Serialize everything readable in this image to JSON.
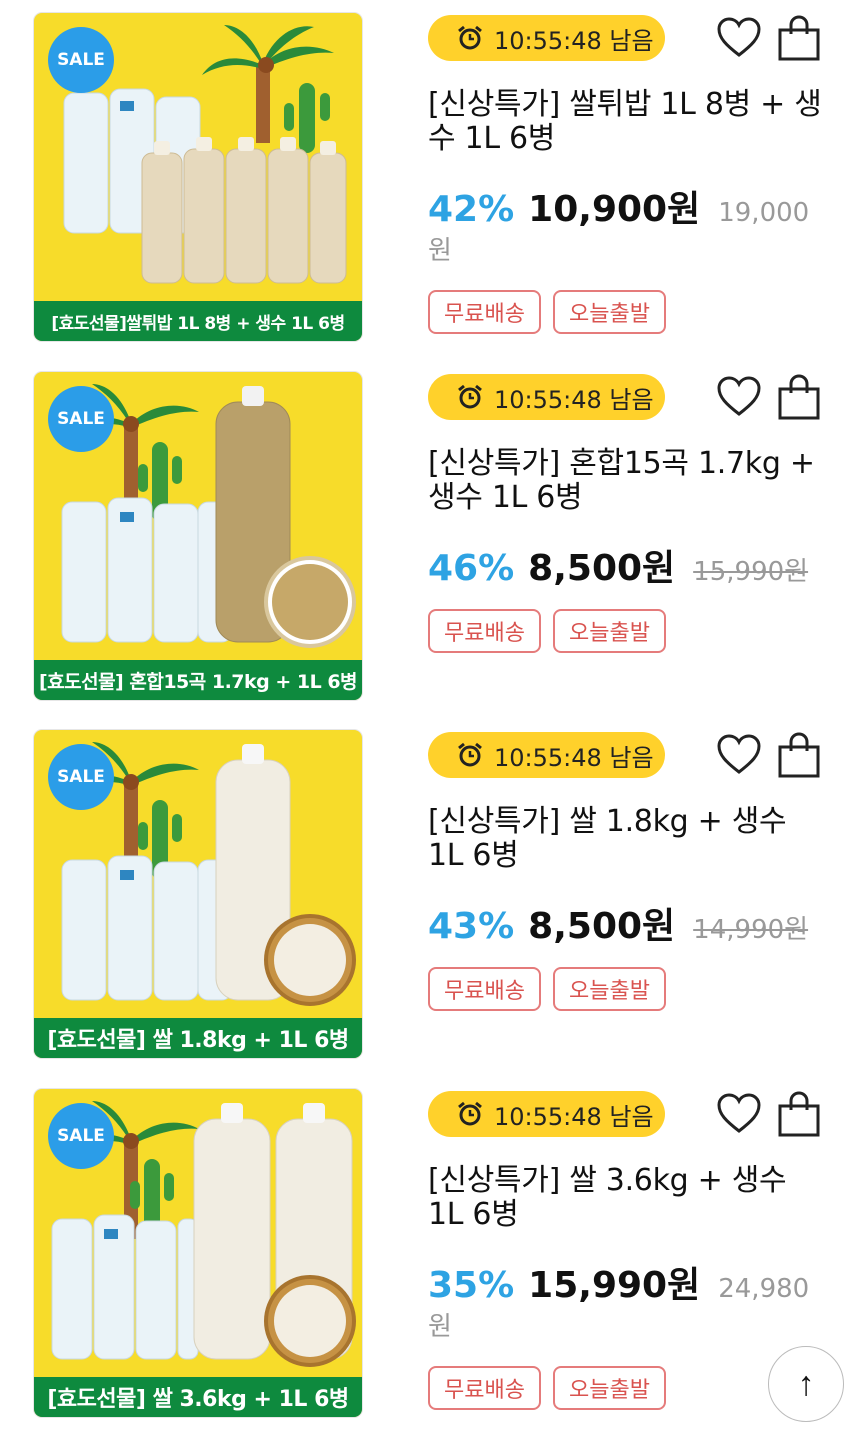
{
  "products": [
    {
      "badge": "SALE",
      "image_caption": "[효도선물]쌀튀밥 1L 8병 + 생수 1L 6병",
      "timer": "10:55:48 남음",
      "title": "[신상특가] 쌀튀밥 1L 8병 + 생수 1L 6병",
      "discount": "42%",
      "price": "10,900원",
      "original_price": "19,000",
      "original_price_unit": "원",
      "tags": [
        "무료배송",
        "오늘출발"
      ]
    },
    {
      "badge": "SALE",
      "image_caption": "[효도선물] 혼합15곡 1.7kg + 1L 6병",
      "timer": "10:55:48 남음",
      "title": "[신상특가] 혼합15곡 1.7kg + 생수 1L 6병",
      "discount": "46%",
      "price": "8,500원",
      "original_price": "15,990원",
      "tags": [
        "무료배송",
        "오늘출발"
      ]
    },
    {
      "badge": "SALE",
      "image_caption": "[효도선물] 쌀 1.8kg + 1L 6병",
      "timer": "10:55:48 남음",
      "title": "[신상특가] 쌀 1.8kg + 생수 1L 6병",
      "discount": "43%",
      "price": "8,500원",
      "original_price": "14,990원",
      "tags": [
        "무료배송",
        "오늘출발"
      ]
    },
    {
      "badge": "SALE",
      "image_caption": "[효도선물] 쌀 3.6kg + 1L 6병",
      "timer": "10:55:48 남음",
      "title": "[신상특가] 쌀 3.6kg + 생수 1L 6병",
      "discount": "35%",
      "price": "15,990원",
      "original_price": "24,980",
      "original_price_unit": "원",
      "tags": [
        "무료배송",
        "오늘출발"
      ]
    }
  ],
  "icons": {
    "timer": "alarm-clock-icon",
    "wishlist": "heart-icon",
    "cart": "shopping-bag-icon",
    "scroll_top": "arrow-up-icon"
  },
  "scroll_top_glyph": "↑",
  "colors": {
    "thumb_bg": "#f7dc2a",
    "banner": "#0e8a3e",
    "sale_badge": "#2b9de8",
    "timer_bg": "#ffd12b",
    "discount": "#2ea3e3",
    "tag_border": "#e57b7b",
    "tag_text": "#d9534f"
  }
}
